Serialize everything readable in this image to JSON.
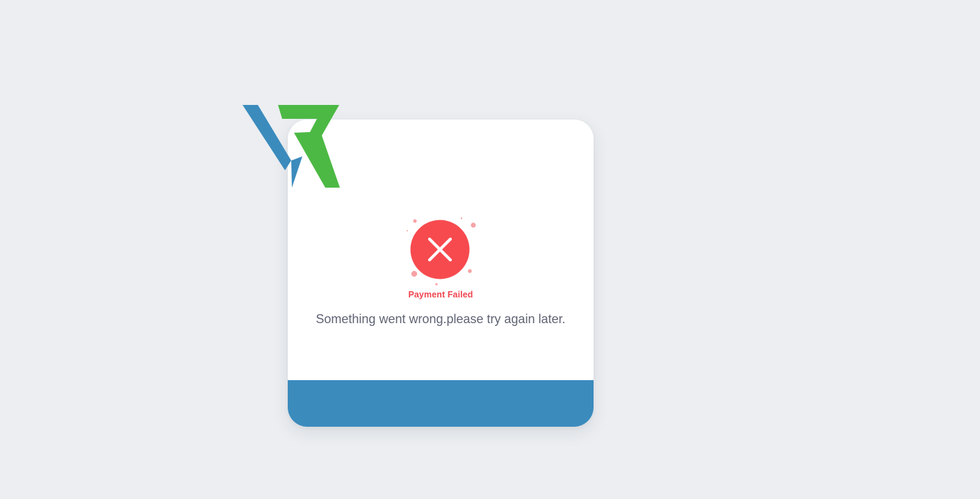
{
  "page": {
    "background_color": "#eceef1"
  },
  "logo": {
    "icon": "vr-brand-logo-icon",
    "colors": {
      "left": "#3b8bbd",
      "right": "#4cb944"
    }
  },
  "card": {
    "status": {
      "icon": "payment-failed-x-icon",
      "label": "Payment Failed",
      "color": "#f0454f"
    },
    "message": "Something went wrong.please try again later.",
    "footer_color": "#3b8bbd"
  }
}
